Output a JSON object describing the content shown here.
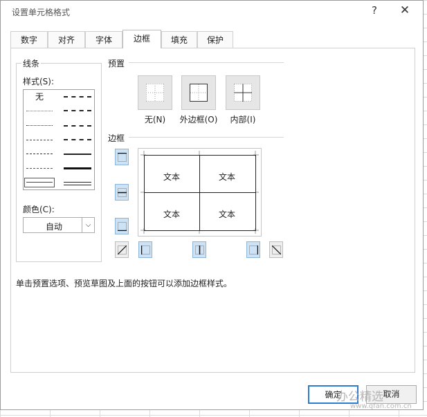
{
  "dialog": {
    "title": "设置单元格格式",
    "help_glyph": "?",
    "close_glyph": "✕"
  },
  "tabs": [
    {
      "label": "数字"
    },
    {
      "label": "对齐"
    },
    {
      "label": "字体"
    },
    {
      "label": "边框",
      "active": true
    },
    {
      "label": "填充"
    },
    {
      "label": "保护"
    }
  ],
  "line": {
    "group_title": "线条",
    "style_label": "样式(S):",
    "none_option": "无",
    "color_label": "颜色(C):",
    "color_value": "自动",
    "dropdown_glyph": "⌵"
  },
  "presets": {
    "title": "预置",
    "items": [
      {
        "label": "无(N)",
        "icon": "preset-none-icon"
      },
      {
        "label": "外边框(O)",
        "icon": "preset-outline-icon"
      },
      {
        "label": "内部(I)",
        "icon": "preset-inside-icon"
      }
    ]
  },
  "border": {
    "title": "边框",
    "preview_cells": [
      "文本",
      "文本",
      "文本",
      "文本"
    ]
  },
  "hint": "单击预置选项、预览草图及上面的按钮可以添加边框样式。",
  "buttons": {
    "ok": "确定",
    "cancel": "取消"
  },
  "watermark": {
    "text": "办公精选",
    "url": "www.qfan.com.cn"
  },
  "colors": {
    "accent": "#2a7bd1",
    "toggle_on_bg": "#cde3f5",
    "toggle_on_border": "#8cb4d8"
  }
}
